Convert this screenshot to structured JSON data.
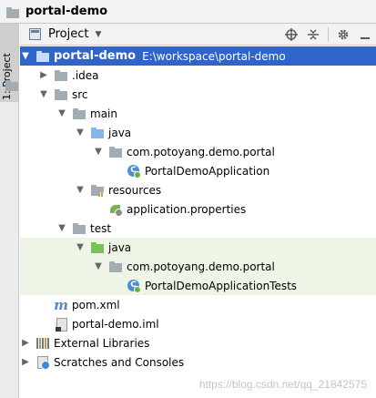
{
  "window": {
    "title": "portal-demo"
  },
  "side_panel": {
    "tab_label": "1: Project"
  },
  "toolbar": {
    "view_label": "Project",
    "caret": "▼"
  },
  "tree": [
    {
      "label": "portal-demo",
      "path": "E:\\workspace\\portal-demo",
      "arrow": "▼",
      "icon": "module-folder",
      "selected": true
    },
    {
      "label": ".idea",
      "arrow": "▶",
      "icon": "folder"
    },
    {
      "label": "src",
      "arrow": "▼",
      "icon": "folder"
    },
    {
      "label": "main",
      "arrow": "▼",
      "icon": "folder"
    },
    {
      "label": "java",
      "arrow": "▼",
      "icon": "source-folder"
    },
    {
      "label": "com.potoyang.demo.portal",
      "arrow": "▼",
      "icon": "package"
    },
    {
      "label": "PortalDemoApplication",
      "arrow": "",
      "icon": "class"
    },
    {
      "label": "resources",
      "arrow": "▼",
      "icon": "resources-folder"
    },
    {
      "label": "application.properties",
      "arrow": "",
      "icon": "properties"
    },
    {
      "label": "test",
      "arrow": "▼",
      "icon": "folder"
    },
    {
      "label": "java",
      "arrow": "▼",
      "icon": "test-source-folder"
    },
    {
      "label": "com.potoyang.demo.portal",
      "arrow": "▼",
      "icon": "package"
    },
    {
      "label": "PortalDemoApplicationTests",
      "arrow": "",
      "icon": "class"
    },
    {
      "label": "pom.xml",
      "arrow": "",
      "icon": "maven-file"
    },
    {
      "label": "portal-demo.iml",
      "arrow": "",
      "icon": "iml-file"
    },
    {
      "label": "External Libraries",
      "arrow": "▶",
      "icon": "libraries"
    },
    {
      "label": "Scratches and Consoles",
      "arrow": "▶",
      "icon": "scratches"
    }
  ],
  "watermark": "https://blog.csdn.net/qq_21842575",
  "colors": {
    "selection": "#2f65ca",
    "test_background": "#eef5e6",
    "source_folder": "#87b7e6",
    "test_folder": "#7bbf58"
  }
}
